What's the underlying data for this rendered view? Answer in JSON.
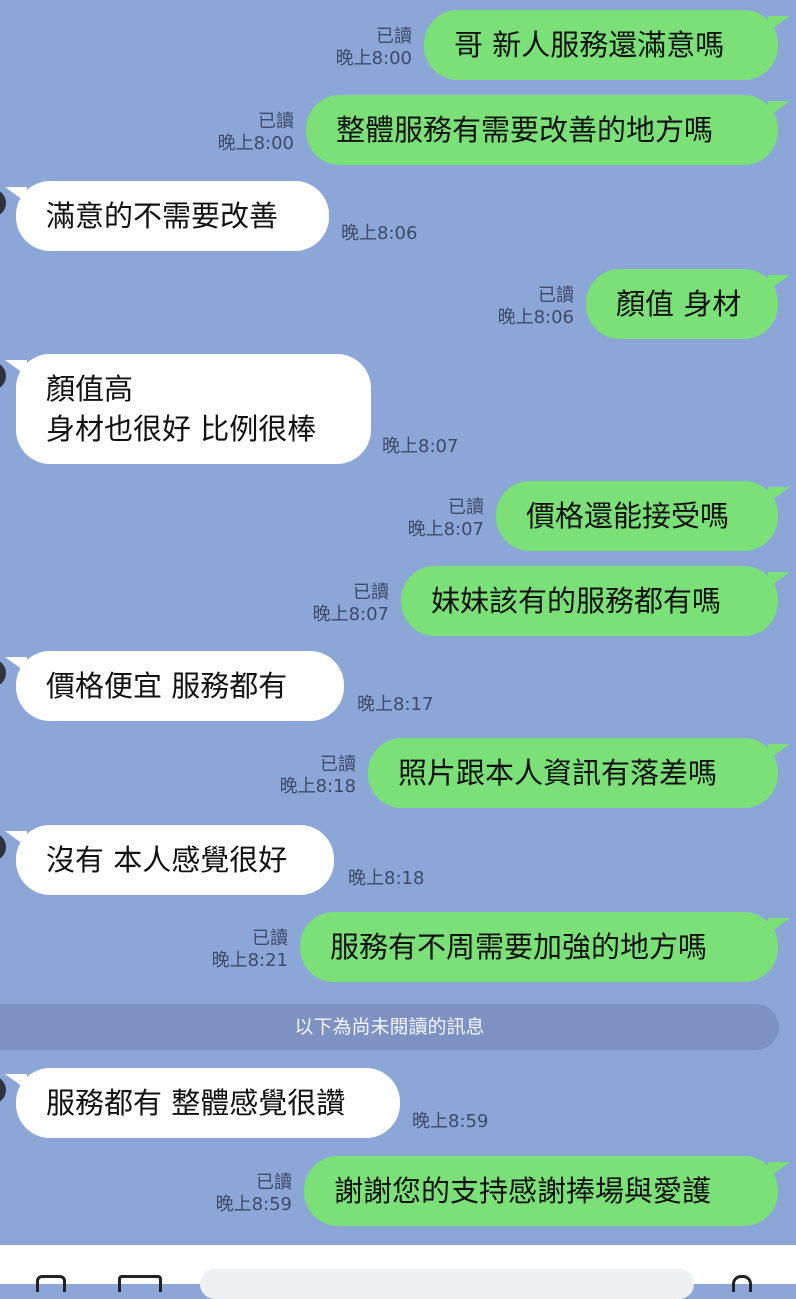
{
  "messages": [
    {
      "dir": "out",
      "text": "哥 新人服務還滿意嗎",
      "read": "已讀",
      "time": "晚上8:00"
    },
    {
      "dir": "out",
      "text": "整體服務有需要改善的地方嗎",
      "read": "已讀",
      "time": "晚上8:00"
    },
    {
      "dir": "in",
      "text": "滿意的不需要改善",
      "time": "晚上8:06"
    },
    {
      "dir": "out",
      "text": "顏值 身材",
      "read": "已讀",
      "time": "晚上8:06"
    },
    {
      "dir": "in",
      "text": "顏值高\n身材也很好 比例很棒",
      "time": "晚上8:07"
    },
    {
      "dir": "out",
      "text": "價格還能接受嗎",
      "read": "已讀",
      "time": "晚上8:07"
    },
    {
      "dir": "out",
      "text": "妹妹該有的服務都有嗎",
      "read": "已讀",
      "time": "晚上8:07"
    },
    {
      "dir": "in",
      "text": "價格便宜 服務都有",
      "time": "晚上8:17"
    },
    {
      "dir": "out",
      "text": "照片跟本人資訊有落差嗎",
      "read": "已讀",
      "time": "晚上8:18"
    },
    {
      "dir": "in",
      "text": "沒有 本人感覺很好",
      "time": "晚上8:18"
    },
    {
      "dir": "out",
      "text": "服務有不周需要加強的地方嗎",
      "read": "已讀",
      "time": "晚上8:21"
    },
    {
      "dir": "in",
      "text": "服務都有 整體感覺很讚",
      "time": "晚上8:59"
    },
    {
      "dir": "out",
      "text": "謝謝您的支持感謝捧場與愛護",
      "read": "已讀",
      "time": "晚上8:59"
    }
  ],
  "unread_divider": "以下為尚未閱讀的訊息",
  "colors": {
    "background": "#8ca6d8",
    "outgoing_bubble": "#7be077",
    "incoming_bubble": "#ffffff"
  },
  "bottom_bar": {
    "icons": [
      "camera-icon",
      "image-icon",
      "mic-icon"
    ]
  }
}
